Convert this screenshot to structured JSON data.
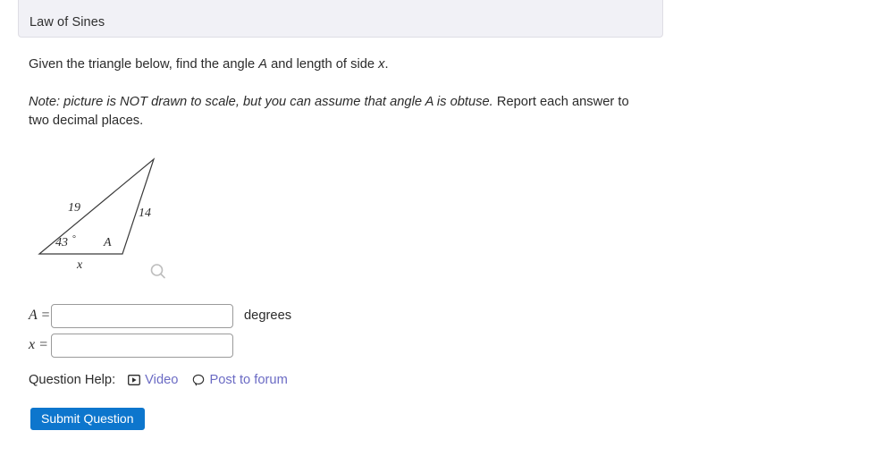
{
  "header": {
    "title": "Law of Sines"
  },
  "prompt": {
    "line1_pre": "Given the triangle below, find the angle ",
    "line1_varA": "A",
    "line1_mid": " and length of side ",
    "line1_varX": "x",
    "line1_end": ".",
    "note_italic": "Note: picture is NOT drawn to scale, but you can assume that angle A is obtuse.",
    "note_rest": " Report each answer to two decimal places."
  },
  "figure": {
    "side_19": "19",
    "side_14": "14",
    "angle_43": "43",
    "degree_symbol": "°",
    "angle_A": "A",
    "base_x": "x",
    "zoom_icon": "magnifier-icon"
  },
  "answers": {
    "a_label": "A =",
    "a_value": "",
    "a_placeholder": "",
    "a_units": "degrees",
    "x_label": "x =",
    "x_value": "",
    "x_placeholder": ""
  },
  "help": {
    "label": "Question Help:",
    "video_icon": "video-play-icon",
    "video_text": "Video",
    "forum_icon": "comment-bubble-icon",
    "forum_text": "Post to forum"
  },
  "submit": {
    "label": "Submit Question"
  },
  "colors": {
    "panel_bg": "#f1f1f6",
    "panel_border": "#dedde4",
    "link": "#6b6bc4",
    "submit_bg": "#0d76cd",
    "text": "#2b2b2b",
    "icon_grey": "#bdbdbd"
  }
}
